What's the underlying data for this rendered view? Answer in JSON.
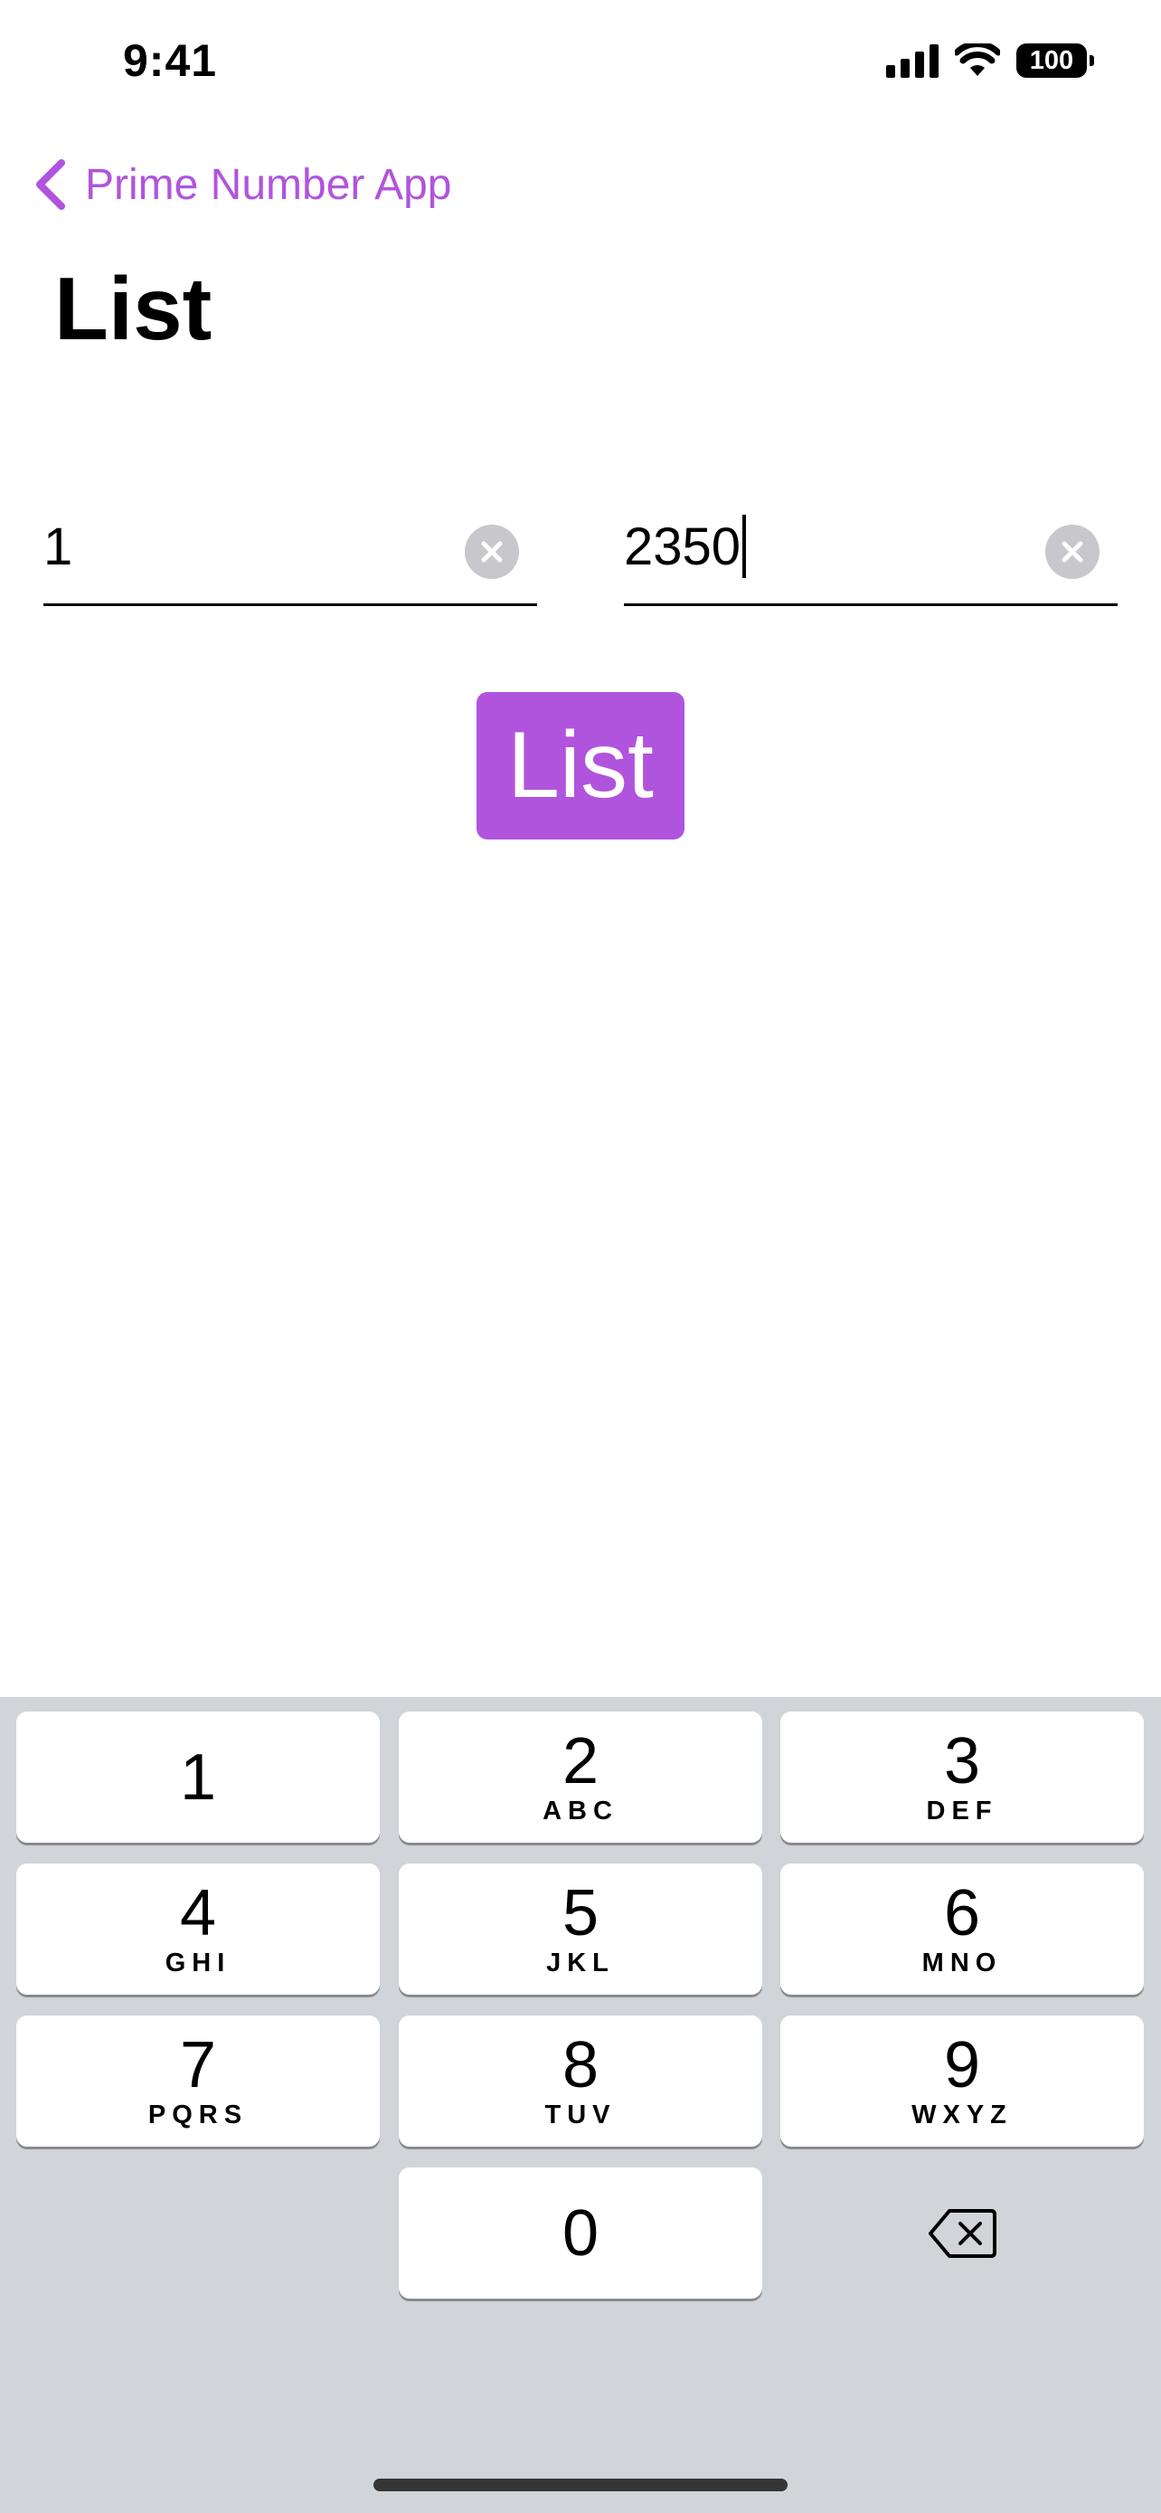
{
  "status_bar": {
    "time": "9:41",
    "battery": "100"
  },
  "nav": {
    "back_label": "Prime Number App",
    "title": "List"
  },
  "fields": {
    "start": {
      "value": "1"
    },
    "end": {
      "value": "2350"
    }
  },
  "action": {
    "label": "List"
  },
  "keyboard": {
    "keys": [
      {
        "digit": "1",
        "letters": ""
      },
      {
        "digit": "2",
        "letters": "ABC"
      },
      {
        "digit": "3",
        "letters": "DEF"
      },
      {
        "digit": "4",
        "letters": "GHI"
      },
      {
        "digit": "5",
        "letters": "JKL"
      },
      {
        "digit": "6",
        "letters": "MNO"
      },
      {
        "digit": "7",
        "letters": "PQRS"
      },
      {
        "digit": "8",
        "letters": "TUV"
      },
      {
        "digit": "9",
        "letters": "WXYZ"
      },
      {
        "digit": "0",
        "letters": ""
      }
    ],
    "delete_icon": "delete-backspace-icon"
  },
  "colors": {
    "accent": "#b154dd",
    "keyboard_bg": "#d1d4d9",
    "clear_button": "#c7c7cc"
  }
}
